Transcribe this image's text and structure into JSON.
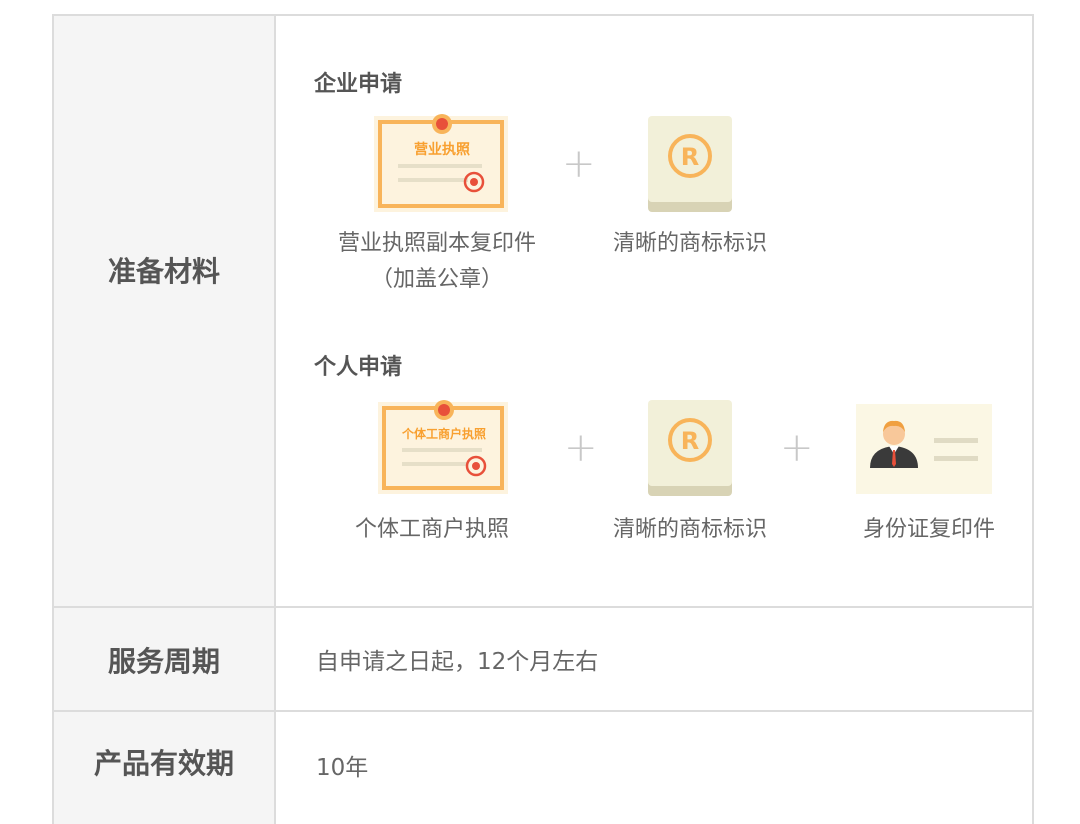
{
  "rows": {
    "materials_label": "准备材料",
    "period_label": "服务周期",
    "validity_label": "产品有效期"
  },
  "company": {
    "title": "企业申请",
    "license_icon_text": "营业执照",
    "license_caption_line1": "营业执照副本复印件",
    "license_caption_line2": "（加盖公章）",
    "trademark_caption": "清晰的商标标识"
  },
  "personal": {
    "title": "个人申请",
    "license_icon_text": "个体工商户执照",
    "license_caption": "个体工商户执照",
    "trademark_caption": "清晰的商标标识",
    "id_caption": "身份证复印件"
  },
  "plus_sign": "+",
  "trademark_symbol": "R",
  "period_value": "自申请之日起，12个月左右",
  "validity_value": "10年",
  "colors": {
    "cert_orange": "#f8b45a",
    "cert_bg": "#fdf3de",
    "seal_red": "#e8503a",
    "trademark_bg": "#f2f0d9",
    "trademark_shadow": "#d8d3b5",
    "id_bg": "#fbf7e4"
  }
}
